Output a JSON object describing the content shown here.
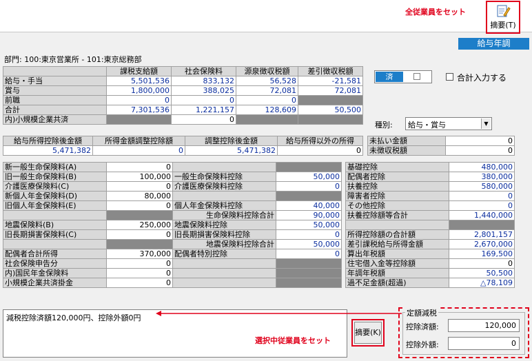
{
  "header": {
    "set_all_note": "全従業員をセット",
    "summary_btn": "摘要(T)",
    "year_end_label": "給与年調"
  },
  "department": "部門:  100:東京営業所 - 101:東京総務部",
  "main_table": {
    "headers": [
      "",
      "課税支給額",
      "社会保険料",
      "源泉徴収税額",
      "差引徴収税額"
    ],
    "rows": [
      [
        "給与・手当",
        "5,501,536",
        "833,132",
        "56,528",
        "-21,581"
      ],
      [
        "賞与",
        "1,800,000",
        "388,025",
        "72,081",
        "72,081"
      ],
      [
        "前職",
        "0",
        "0",
        "0",
        ""
      ],
      [
        "合計",
        "7,301,536",
        "1,221,157",
        "128,609",
        "50,500"
      ],
      [
        "内)小規模企業共済",
        "",
        "0",
        "",
        ""
      ]
    ]
  },
  "done_toggle": {
    "label": "済"
  },
  "total_input": {
    "label": "合計入力する"
  },
  "type_field": {
    "label": "種別:",
    "value": "給与・賞与"
  },
  "income_table": {
    "headers": [
      "給与所得控除後金額",
      "所得金額調整控除額",
      "調整控除後金額",
      "給与所得以外の所得"
    ],
    "values": [
      "5,471,382",
      "0",
      "5,471,382",
      "0"
    ]
  },
  "unpaid": [
    [
      "未払い金額",
      "0"
    ],
    [
      "未徴収税額",
      "0"
    ]
  ],
  "ins_table": {
    "rows": [
      [
        "新一般生命保険料(A)",
        "0",
        "",
        ""
      ],
      [
        "旧一般生命保険料(B)",
        "100,000",
        "一般生命保険料控除",
        "50,000"
      ],
      [
        "介護医療保険料(C)",
        "0",
        "介護医療保険料控除",
        "0"
      ],
      [
        "新個人年金保険料(D)",
        "80,000",
        "",
        ""
      ],
      [
        "旧個人年金保険料(E)",
        "0",
        "個人年金保険料控除",
        "40,000"
      ],
      [
        "",
        "",
        "生命保険料控除合計",
        "90,000"
      ],
      [
        "地震保険料(B)",
        "250,000",
        "地震保険料控除",
        "50,000"
      ],
      [
        "旧長期損害保険料(C)",
        "0",
        "旧長期損害保険料控除",
        "0"
      ],
      [
        "",
        "",
        "地震保険料控除合計",
        "50,000"
      ],
      [
        "配偶者合計所得",
        "370,000",
        "配偶者特別控除",
        "0"
      ],
      [
        "社会保険申告分",
        "0",
        "",
        ""
      ],
      [
        "内)国民年金保険料",
        "0",
        "",
        ""
      ],
      [
        "小規模企業共済掛金",
        "0",
        "",
        ""
      ]
    ]
  },
  "ded_table": {
    "rows": [
      [
        "基礎控除",
        "480,000"
      ],
      [
        "配偶者控除",
        "380,000"
      ],
      [
        "扶養控除",
        "580,000"
      ],
      [
        "障害者控除",
        "0"
      ],
      [
        "その他控除",
        "0"
      ],
      [
        "扶養控除額等合計",
        "1,440,000"
      ],
      [
        "",
        ""
      ],
      [
        "所得控除額の合計額",
        "2,801,157"
      ],
      [
        "差引課税給与所得金額",
        "2,670,000"
      ],
      [
        "算出年税額",
        "169,500"
      ],
      [
        "住宅借入金等控除額",
        "0"
      ],
      [
        "年調年税額",
        "50,500"
      ],
      [
        "過不足金額(超過)",
        "△78,109"
      ]
    ]
  },
  "memo_text": "減税控除済額120,000円、控除外額0円",
  "selected_note": "選択中従業員をセット",
  "summary_btn2": "摘要(K)",
  "fixed_tax": {
    "title": "定額減税",
    "deducted_label": "控除済額:",
    "deducted_value": "120,000",
    "excluded_label": "控除外額:",
    "excluded_value": "0"
  }
}
